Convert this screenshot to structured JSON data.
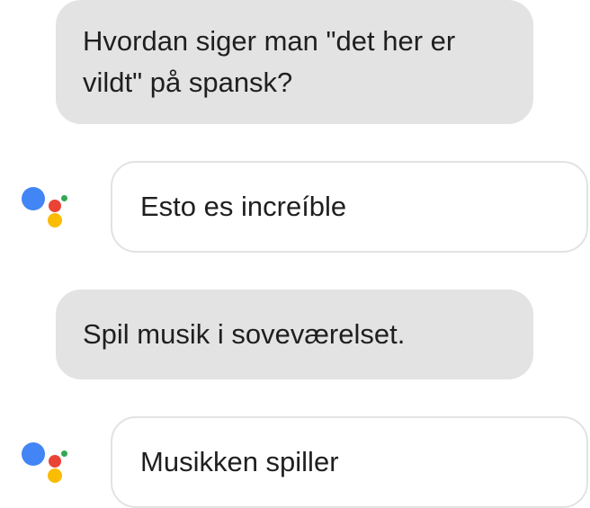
{
  "conversation": {
    "messages": [
      {
        "role": "user",
        "text": "Hvordan siger man \"det her er vildt\" på spansk?"
      },
      {
        "role": "assistant",
        "text": "Esto es increíble"
      },
      {
        "role": "user",
        "text": "Spil musik i soveværelset."
      },
      {
        "role": "assistant",
        "text": "Musikken spiller"
      }
    ]
  },
  "assistant_logo": {
    "icon": "google-assistant-logo",
    "colors": {
      "blue": "#4285F4",
      "red": "#EA4335",
      "yellow": "#FBBC04",
      "green": "#34A853"
    }
  }
}
